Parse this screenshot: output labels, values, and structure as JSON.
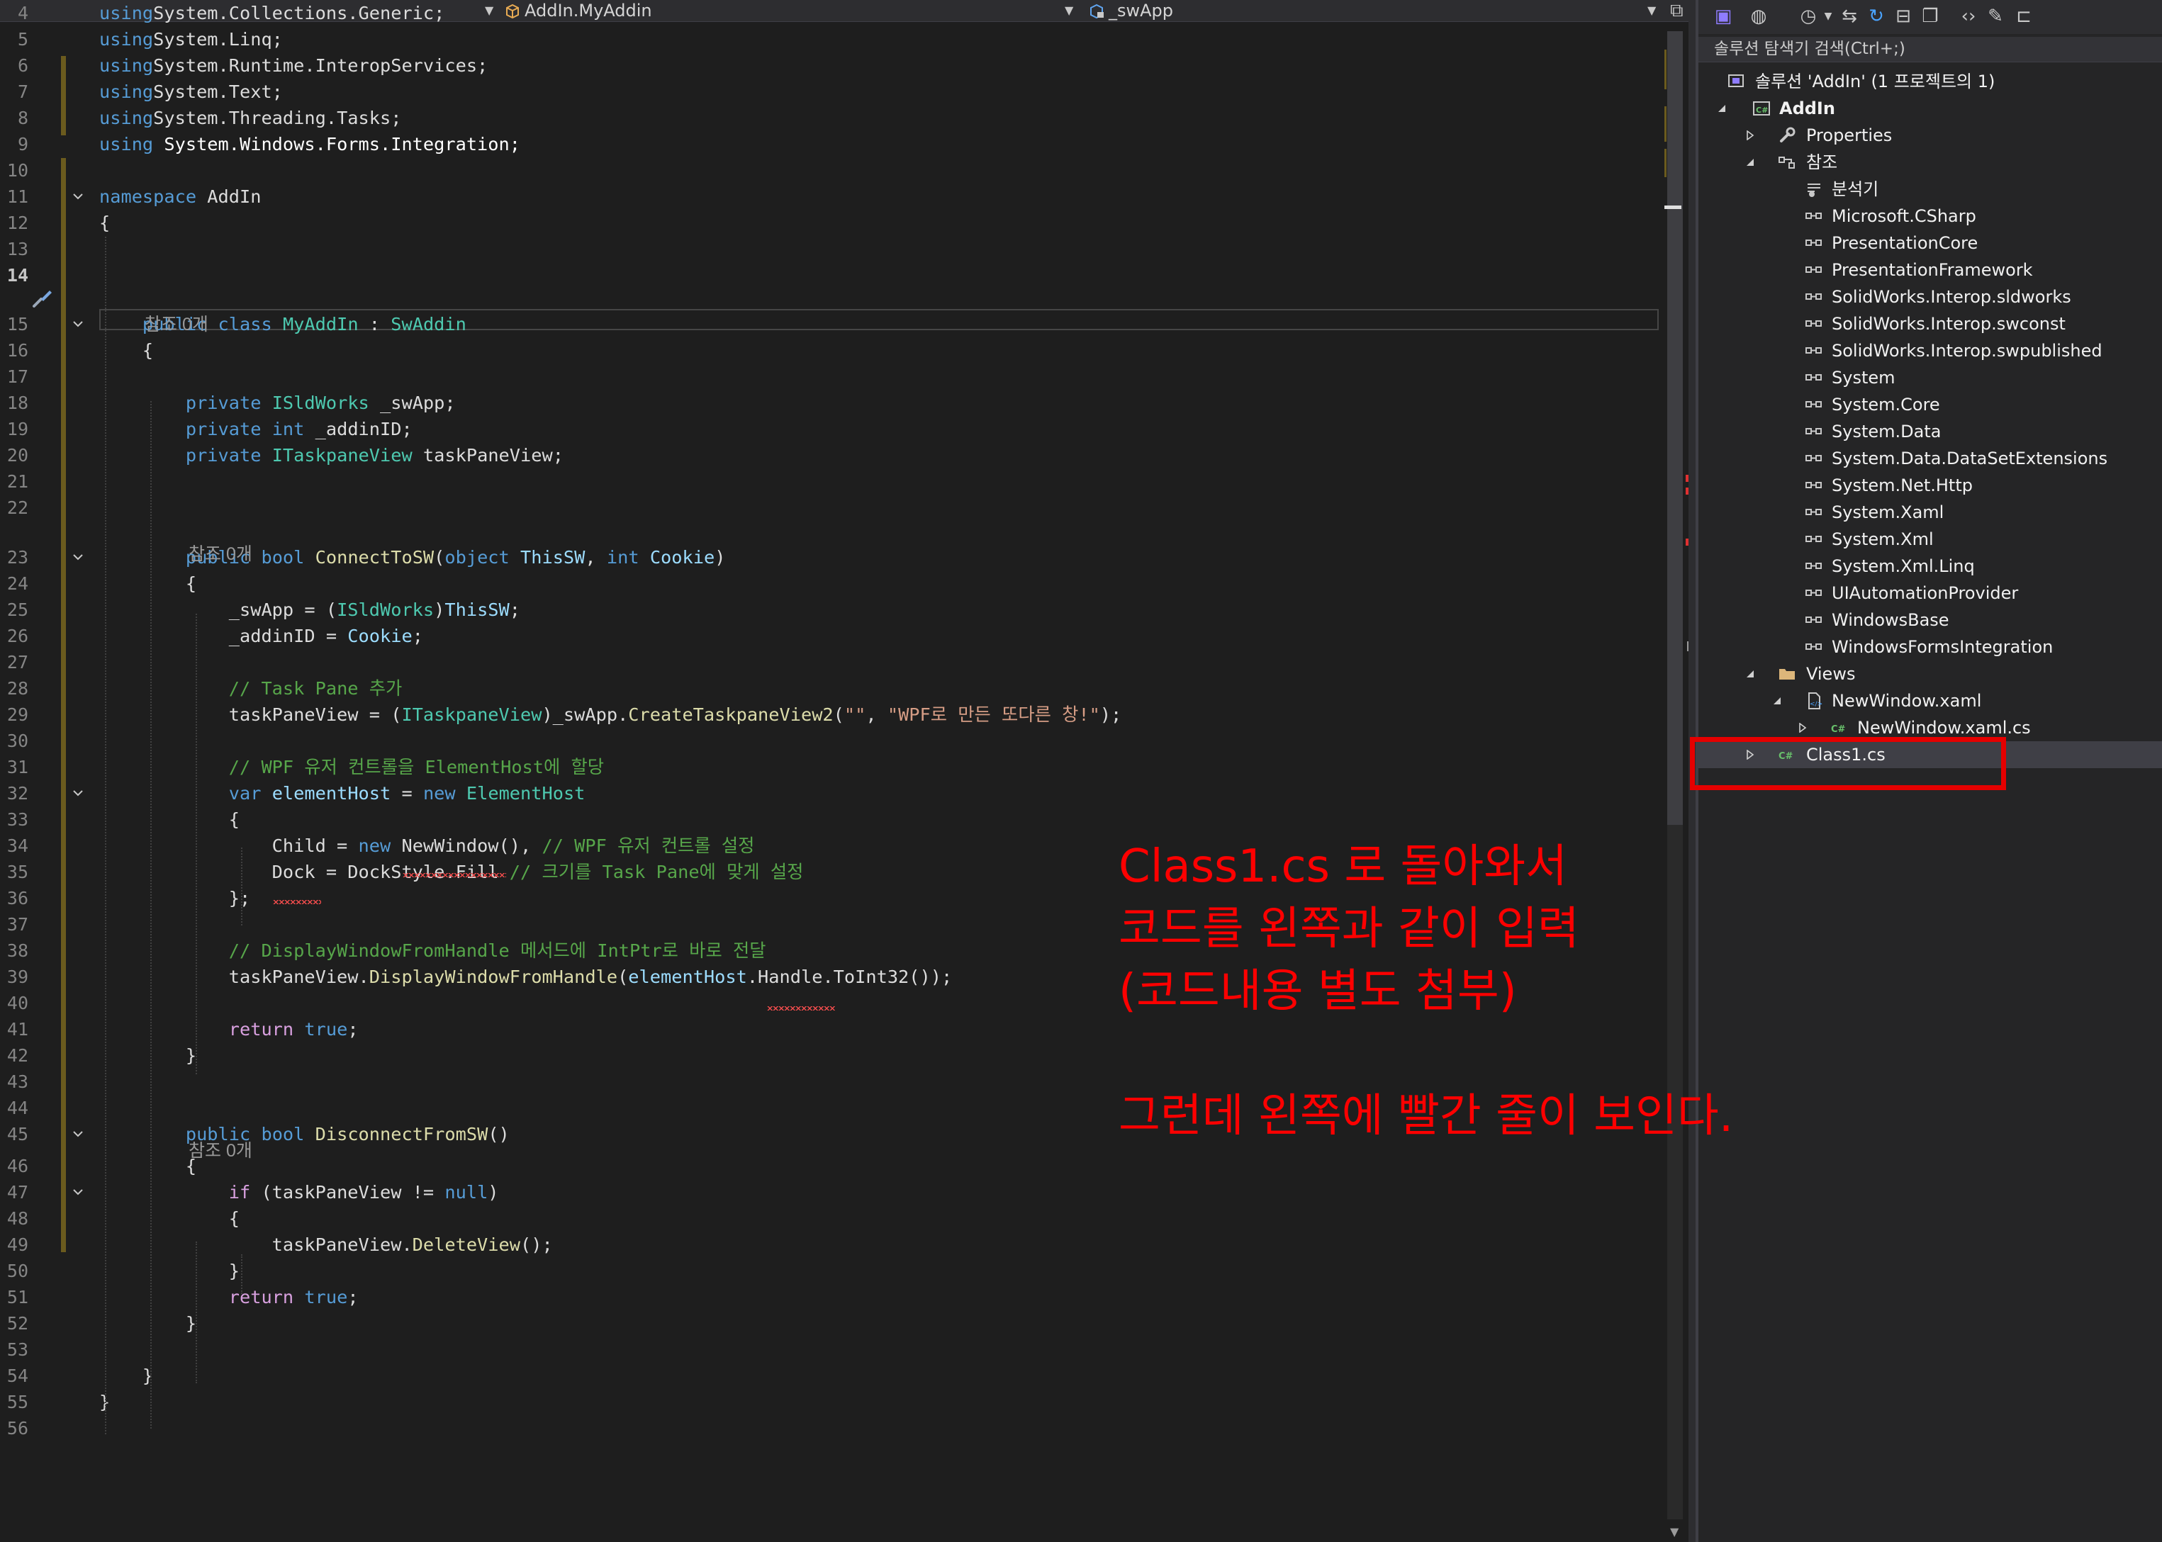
{
  "navbar": {
    "class_dropdown": "AddIn.MyAddin",
    "member_dropdown": "_swApp"
  },
  "editor": {
    "lines": [
      {
        "num": "4",
        "segs": [
          [
            "kw",
            "using"
          ],
          [
            "",
            "System.Collections.Generic;"
          ]
        ]
      },
      {
        "num": "5",
        "segs": [
          [
            "kw",
            "using"
          ],
          [
            "",
            "System.Linq;"
          ]
        ]
      },
      {
        "num": "6",
        "segs": [
          [
            "kw",
            "using"
          ],
          [
            "",
            "System.Runtime.InteropServices;"
          ]
        ]
      },
      {
        "num": "7",
        "segs": [
          [
            "kw",
            "using"
          ],
          [
            "",
            "System.Text;"
          ]
        ]
      },
      {
        "num": "8",
        "segs": [
          [
            "kw",
            "using"
          ],
          [
            "",
            "System.Threading.Tasks;"
          ]
        ]
      },
      {
        "num": "9",
        "segs": [
          [
            "kw",
            "using"
          ],
          [
            "ns",
            " System.Windows.Forms.Integration;"
          ]
        ]
      },
      {
        "num": "10",
        "segs": []
      },
      {
        "num": "11",
        "segs": [
          [
            "kw",
            "namespace"
          ],
          [
            "",
            " AddIn"
          ]
        ]
      },
      {
        "num": "12",
        "segs": [
          [
            "",
            "{"
          ]
        ]
      },
      {
        "num": "13",
        "segs": []
      },
      {
        "num": "14",
        "segs": [],
        "active": true
      },
      {
        "num": "15",
        "segs": [
          [
            "",
            "    "
          ],
          [
            "kw",
            "public"
          ],
          [
            "",
            " "
          ],
          [
            "kw",
            "class"
          ],
          [
            "",
            " "
          ],
          [
            "ty",
            "MyAddIn"
          ],
          [
            "",
            " : "
          ],
          [
            "ty",
            "SwAddin"
          ]
        ]
      },
      {
        "num": "16",
        "segs": [
          [
            "",
            "    {"
          ]
        ]
      },
      {
        "num": "17",
        "segs": []
      },
      {
        "num": "18",
        "segs": [
          [
            "",
            "        "
          ],
          [
            "kw",
            "private"
          ],
          [
            "",
            " "
          ],
          [
            "ty",
            "ISldWorks"
          ],
          [
            "",
            " _swApp;"
          ]
        ]
      },
      {
        "num": "19",
        "segs": [
          [
            "",
            "        "
          ],
          [
            "kw",
            "private"
          ],
          [
            "",
            " "
          ],
          [
            "kw",
            "int"
          ],
          [
            "",
            " _addinID;"
          ]
        ]
      },
      {
        "num": "20",
        "segs": [
          [
            "",
            "        "
          ],
          [
            "kw",
            "private"
          ],
          [
            "",
            " "
          ],
          [
            "ty",
            "ITaskpaneView"
          ],
          [
            "",
            " taskPaneView;"
          ]
        ]
      },
      {
        "num": "21",
        "segs": []
      },
      {
        "num": "22",
        "segs": []
      },
      {
        "num": "23",
        "segs": [
          [
            "",
            "        "
          ],
          [
            "kw",
            "public"
          ],
          [
            "",
            " "
          ],
          [
            "kw",
            "bool"
          ],
          [
            "",
            " "
          ],
          [
            "fn",
            "ConnectToSW"
          ],
          [
            "",
            "("
          ],
          [
            "kw",
            "object"
          ],
          [
            "",
            " "
          ],
          [
            "pm",
            "ThisSW"
          ],
          [
            "",
            ", "
          ],
          [
            "kw",
            "int"
          ],
          [
            "",
            " "
          ],
          [
            "pm",
            "Cookie"
          ],
          [
            "",
            ")"
          ]
        ]
      },
      {
        "num": "24",
        "segs": [
          [
            "",
            "        {"
          ]
        ]
      },
      {
        "num": "25",
        "segs": [
          [
            "",
            "            _swApp = ("
          ],
          [
            "ty",
            "ISldWorks"
          ],
          [
            "",
            ")"
          ],
          [
            "pm",
            "ThisSW"
          ],
          [
            "",
            ";"
          ]
        ]
      },
      {
        "num": "26",
        "segs": [
          [
            "",
            "            _addinID = "
          ],
          [
            "pm",
            "Cookie"
          ],
          [
            "",
            ";"
          ]
        ]
      },
      {
        "num": "27",
        "segs": []
      },
      {
        "num": "28",
        "segs": [
          [
            "",
            "            "
          ],
          [
            "cm",
            "// Task Pane 추가"
          ]
        ]
      },
      {
        "num": "29",
        "segs": [
          [
            "",
            "            taskPaneView = ("
          ],
          [
            "ty",
            "ITaskpaneView"
          ],
          [
            "",
            ")_swApp."
          ],
          [
            "fn",
            "CreateTaskpaneView2"
          ],
          [
            "",
            "("
          ],
          [
            "st",
            "\"\""
          ],
          [
            "",
            ", "
          ],
          [
            "st",
            "\"WPF로 만든 또다른 창!\""
          ],
          [
            "",
            ");"
          ]
        ]
      },
      {
        "num": "30",
        "segs": []
      },
      {
        "num": "31",
        "segs": [
          [
            "",
            "            "
          ],
          [
            "cm",
            "// WPF 유저 컨트롤을 ElementHost에 할당"
          ]
        ]
      },
      {
        "num": "32",
        "segs": [
          [
            "",
            "            "
          ],
          [
            "kw",
            "var"
          ],
          [
            "",
            " "
          ],
          [
            "pm",
            "elementHost"
          ],
          [
            "",
            " = "
          ],
          [
            "kw",
            "new"
          ],
          [
            "",
            " "
          ],
          [
            "ty",
            "ElementHost"
          ]
        ]
      },
      {
        "num": "33",
        "segs": [
          [
            "",
            "            {"
          ]
        ]
      },
      {
        "num": "34",
        "segs": [
          [
            "",
            "                Child = "
          ],
          [
            "kw",
            "new"
          ],
          [
            "",
            " NewWindow(), "
          ],
          [
            "cm",
            "// WPF 유저 컨트롤 설정"
          ]
        ]
      },
      {
        "num": "35",
        "segs": [
          [
            "",
            "                Dock = DockStyle.Fill "
          ],
          [
            "cm",
            "// 크기를 Task Pane에 맞게 설정"
          ]
        ]
      },
      {
        "num": "36",
        "segs": [
          [
            "",
            "            };"
          ]
        ]
      },
      {
        "num": "37",
        "segs": []
      },
      {
        "num": "38",
        "segs": [
          [
            "",
            "            "
          ],
          [
            "cm",
            "// DisplayWindowFromHandle 메서드에 IntPtr로 바로 전달"
          ]
        ]
      },
      {
        "num": "39",
        "segs": [
          [
            "",
            "            taskPaneView."
          ],
          [
            "fn",
            "DisplayWindowFromHandle"
          ],
          [
            "",
            "("
          ],
          [
            "pm",
            "elementHost"
          ],
          [
            "",
            ".Handle.ToInt32());"
          ]
        ]
      },
      {
        "num": "40",
        "segs": []
      },
      {
        "num": "41",
        "segs": [
          [
            "",
            "            "
          ],
          [
            "ctl",
            "return"
          ],
          [
            "",
            " "
          ],
          [
            "kw",
            "true"
          ],
          [
            "",
            ";"
          ]
        ]
      },
      {
        "num": "42",
        "segs": [
          [
            "",
            "        }"
          ]
        ]
      },
      {
        "num": "43",
        "segs": []
      },
      {
        "num": "44",
        "segs": []
      },
      {
        "num": "45",
        "segs": [
          [
            "",
            "        "
          ],
          [
            "kw",
            "public"
          ],
          [
            "",
            " "
          ],
          [
            "kw",
            "bool"
          ],
          [
            "",
            " "
          ],
          [
            "fn",
            "DisconnectFromSW"
          ],
          [
            "",
            "()"
          ]
        ]
      },
      {
        "num": "46",
        "segs": [
          [
            "",
            "        {"
          ]
        ]
      },
      {
        "num": "47",
        "segs": [
          [
            "",
            "            "
          ],
          [
            "ctl",
            "if"
          ],
          [
            "",
            " (taskPaneView != "
          ],
          [
            "kw",
            "null"
          ],
          [
            "",
            ")"
          ]
        ]
      },
      {
        "num": "48",
        "segs": [
          [
            "",
            "            {"
          ]
        ]
      },
      {
        "num": "49",
        "segs": [
          [
            "",
            "                taskPaneView."
          ],
          [
            "fn",
            "DeleteView"
          ],
          [
            "",
            "();"
          ]
        ]
      },
      {
        "num": "50",
        "segs": [
          [
            "",
            "            }"
          ]
        ]
      },
      {
        "num": "51",
        "segs": [
          [
            "",
            "            "
          ],
          [
            "ctl",
            "return"
          ],
          [
            "",
            " "
          ],
          [
            "kw",
            "true"
          ],
          [
            "",
            ";"
          ]
        ]
      },
      {
        "num": "52",
        "segs": [
          [
            "",
            "        }"
          ]
        ]
      },
      {
        "num": "53",
        "segs": []
      },
      {
        "num": "54",
        "segs": [
          [
            "",
            "    }"
          ]
        ]
      },
      {
        "num": "55",
        "segs": [
          [
            "",
            "}"
          ]
        ]
      },
      {
        "num": "56",
        "segs": []
      }
    ],
    "codelens": [
      {
        "text": "참조 0개",
        "line_index": 11
      },
      {
        "text": "참조 0개",
        "line_index": 19
      },
      {
        "text": "참조 0개",
        "line_index": 41
      }
    ]
  },
  "explorer": {
    "search_placeholder": "솔루션 탐색기 검색(Ctrl+;)",
    "items": [
      {
        "label": "솔루션 'AddIn' (1 프로젝트의 1)",
        "icon": "solution-icon"
      },
      {
        "label": "AddIn",
        "icon": "csharp-project-icon"
      },
      {
        "label": "Properties",
        "icon": "wrench-icon"
      },
      {
        "label": "참조",
        "icon": "references-icon"
      },
      {
        "label": "분석기",
        "icon": "analyzer-icon"
      },
      {
        "label": "Microsoft.CSharp",
        "icon": "reference-icon"
      },
      {
        "label": "PresentationCore",
        "icon": "reference-icon"
      },
      {
        "label": "PresentationFramework",
        "icon": "reference-icon"
      },
      {
        "label": "SolidWorks.Interop.sldworks",
        "icon": "reference-icon"
      },
      {
        "label": "SolidWorks.Interop.swconst",
        "icon": "reference-icon"
      },
      {
        "label": "SolidWorks.Interop.swpublished",
        "icon": "reference-icon"
      },
      {
        "label": "System",
        "icon": "reference-icon"
      },
      {
        "label": "System.Core",
        "icon": "reference-icon"
      },
      {
        "label": "System.Data",
        "icon": "reference-icon"
      },
      {
        "label": "System.Data.DataSetExtensions",
        "icon": "reference-icon"
      },
      {
        "label": "System.Net.Http",
        "icon": "reference-icon"
      },
      {
        "label": "System.Xaml",
        "icon": "reference-icon"
      },
      {
        "label": "System.Xml",
        "icon": "reference-icon"
      },
      {
        "label": "System.Xml.Linq",
        "icon": "reference-icon"
      },
      {
        "label": "UIAutomationProvider",
        "icon": "reference-icon"
      },
      {
        "label": "WindowsBase",
        "icon": "reference-icon"
      },
      {
        "label": "WindowsFormsIntegration",
        "icon": "reference-icon"
      },
      {
        "label": "Views",
        "icon": "folder-icon"
      },
      {
        "label": "NewWindow.xaml",
        "icon": "xaml-file-icon"
      },
      {
        "label": "NewWindow.xaml.cs",
        "icon": "cs-file-icon"
      },
      {
        "label": "Class1.cs",
        "icon": "cs-file-icon"
      }
    ]
  },
  "annotation": {
    "lines": [
      "Class1.cs 로 돌아와서",
      "코드를 왼쪽과 같이 입력",
      "(코드내용 별도 첨부)",
      "",
      "그런데 왼쪽에 빨간 줄이 보인다."
    ]
  },
  "colors": {
    "editor_bg": "#1e1e1e",
    "explorer_bg": "#252526",
    "keyword": "#569cd6",
    "type": "#4ec9b0",
    "string": "#d69d85",
    "comment": "#57a64a",
    "annotation_red": "#ff0000"
  }
}
